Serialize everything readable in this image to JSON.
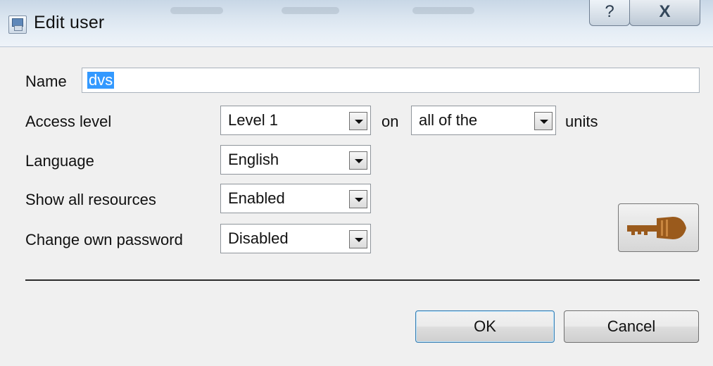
{
  "window": {
    "title": "Edit user",
    "help_symbol": "?",
    "close_symbol": "X"
  },
  "form": {
    "name_label": "Name",
    "name_value": "dvs",
    "access_label": "Access level",
    "access_value": "Level 1",
    "on_text": "on",
    "units_value": "all of the",
    "units_text": "units",
    "language_label": "Language",
    "language_value": "English",
    "resources_label": "Show all resources",
    "resources_value": "Enabled",
    "password_label": "Change own password",
    "password_value": "Disabled"
  },
  "buttons": {
    "ok": "OK",
    "cancel": "Cancel"
  },
  "icons": {
    "app": "user-edit-icon",
    "key": "key-icon"
  },
  "colors": {
    "selection": "#3399ff",
    "key_brown": "#9a5a1c"
  }
}
